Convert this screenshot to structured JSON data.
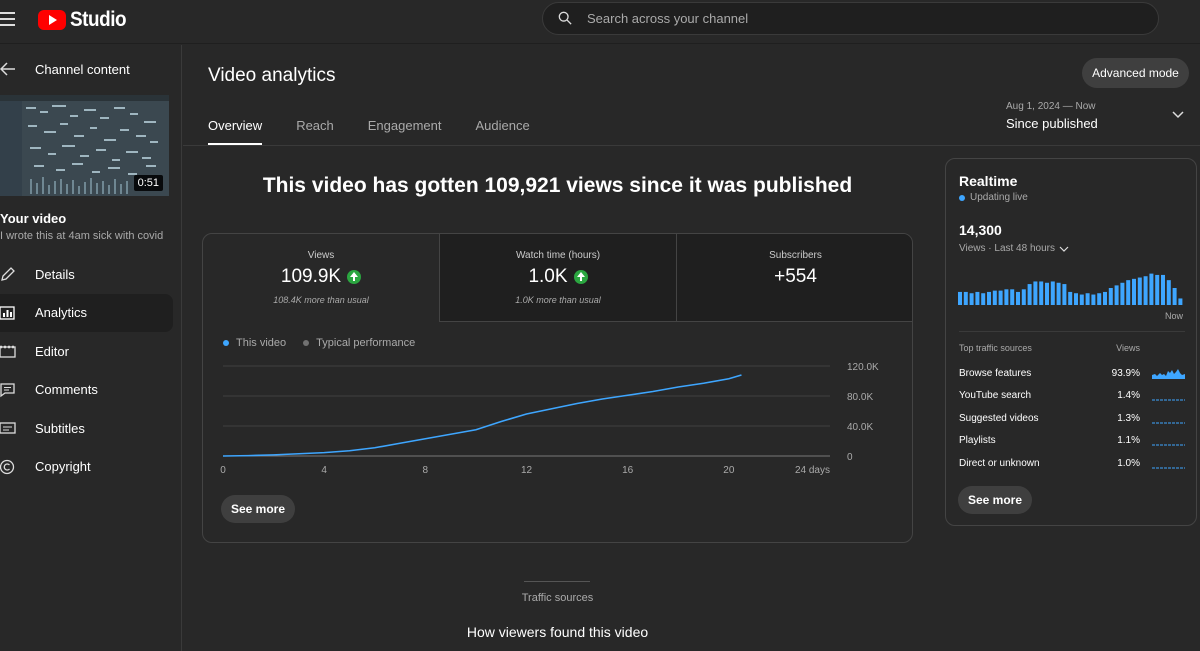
{
  "app": {
    "logo_text": "Studio"
  },
  "search": {
    "placeholder": "Search across your channel"
  },
  "sidebar": {
    "back_label": "Channel content",
    "thumbnail_duration": "0:51",
    "your_video": "Your video",
    "video_title": "I wrote this at 4am sick with covid",
    "items": [
      {
        "label": "Details",
        "icon": "pencil-icon",
        "active": false
      },
      {
        "label": "Analytics",
        "icon": "analytics-icon",
        "active": true
      },
      {
        "label": "Editor",
        "icon": "clapper-icon",
        "active": false
      },
      {
        "label": "Comments",
        "icon": "comment-icon",
        "active": false
      },
      {
        "label": "Subtitles",
        "icon": "subtitles-icon",
        "active": false
      },
      {
        "label": "Copyright",
        "icon": "copyright-icon",
        "active": false
      }
    ]
  },
  "header": {
    "title": "Video analytics",
    "advanced_mode": "Advanced mode",
    "tabs": [
      "Overview",
      "Reach",
      "Engagement",
      "Audience"
    ],
    "active_tab": "Overview",
    "date_range_sub": "Aug 1, 2024 — Now",
    "date_range_main": "Since published"
  },
  "overview": {
    "headline": "This video has gotten 109,921 views since it was published",
    "metrics": [
      {
        "label": "Views",
        "value": "109.9K",
        "sub": "108.4K more than usual",
        "trend": "up"
      },
      {
        "label": "Watch time (hours)",
        "value": "1.0K",
        "sub": "1.0K more than usual",
        "trend": "up"
      },
      {
        "label": "Subscribers",
        "value": "+554",
        "sub": "",
        "trend": ""
      }
    ],
    "legend": [
      {
        "label": "This video",
        "color": "#3ea6ff"
      },
      {
        "label": "Typical performance",
        "color": "#717171"
      }
    ],
    "see_more": "See more"
  },
  "chart_data": {
    "type": "line",
    "series": [
      {
        "name": "This video",
        "color": "#3ea6ff",
        "x": [
          0,
          1,
          2,
          3,
          4,
          5,
          6,
          7,
          8,
          9,
          10,
          11,
          12,
          13,
          14,
          15,
          16,
          17,
          18,
          19,
          20,
          20.5
        ],
        "y": [
          0,
          500,
          1500,
          3000,
          4500,
          7000,
          11000,
          17000,
          23000,
          29000,
          35000,
          46000,
          56000,
          63000,
          70000,
          76000,
          81000,
          86000,
          92000,
          97000,
          103000,
          108000
        ]
      }
    ],
    "x_ticks": [
      "0",
      "4",
      "8",
      "12",
      "16",
      "20",
      "24 days"
    ],
    "x_tick_values": [
      0,
      4,
      8,
      12,
      16,
      20,
      24
    ],
    "y_ticks": [
      "0",
      "40.0K",
      "80.0K",
      "120.0K"
    ],
    "y_tick_values": [
      0,
      40000,
      80000,
      120000
    ],
    "xlim": [
      0,
      24
    ],
    "ylim": [
      0,
      120000
    ],
    "grid": true
  },
  "realtime": {
    "title": "Realtime",
    "status": "Updating live",
    "count": "14,300",
    "period": "Views · Last 48 hours",
    "now_label": "Now",
    "bars": [
      10,
      10,
      9,
      10,
      9,
      10,
      11,
      11,
      12,
      12,
      10,
      12,
      16,
      18,
      18,
      17,
      18,
      17,
      16,
      10,
      9,
      8,
      9,
      8,
      9,
      10,
      13,
      15,
      17,
      19,
      20,
      21,
      22,
      24,
      23,
      23,
      19,
      13,
      5
    ],
    "traffic_header": "Top traffic sources",
    "views_header": "Views",
    "sources": [
      {
        "label": "Browse features",
        "pct": "93.9%"
      },
      {
        "label": "YouTube search",
        "pct": "1.4%"
      },
      {
        "label": "Suggested videos",
        "pct": "1.3%"
      },
      {
        "label": "Playlists",
        "pct": "1.1%"
      },
      {
        "label": "Direct or unknown",
        "pct": "1.0%"
      }
    ],
    "see_more": "See more"
  },
  "traffic_section": {
    "label": "Traffic sources",
    "title": "How viewers found this video"
  }
}
